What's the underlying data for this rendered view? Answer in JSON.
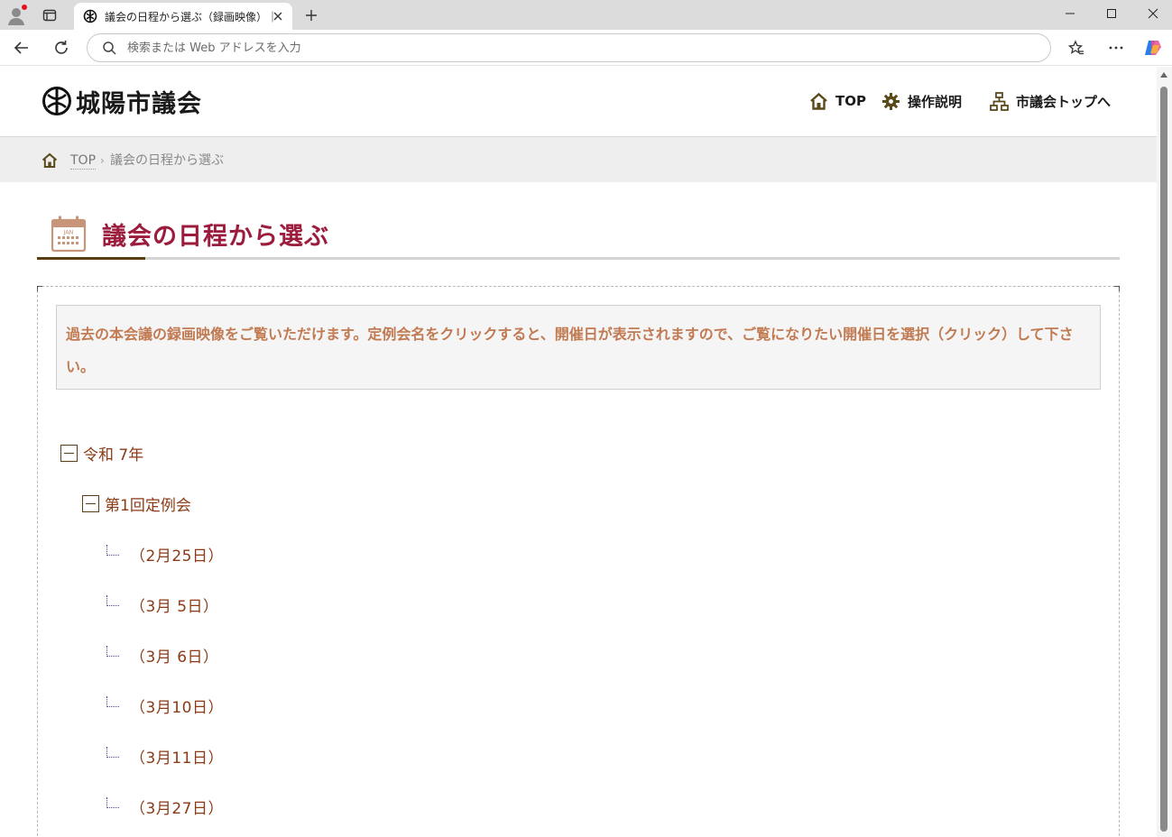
{
  "browser": {
    "tab_title": "議会の日程から選ぶ（録画映像）｜",
    "address_placeholder": "検索または Web アドレスを入力"
  },
  "site": {
    "logo_text": "城陽市議会",
    "nav": [
      {
        "label": "TOP",
        "icon": "home-icon"
      },
      {
        "label": "操作説明",
        "icon": "gear-icon"
      },
      {
        "label": "市議会トップへ",
        "icon": "sitemap-icon"
      }
    ]
  },
  "breadcrumb": {
    "home": "TOP",
    "separator": "›",
    "current": "議会の日程から選ぶ"
  },
  "page": {
    "title": "議会の日程から選ぶ",
    "calendar_label": "JAN",
    "notice": "過去の本会議の録画映像をご覧いただけます。定例会名をクリックすると、開催日が表示されますので、ご覧になりたい開催日を選択（クリック）して下さい。"
  },
  "tree": {
    "year": "令和 7年",
    "session": "第1回定例会",
    "dates": [
      "（2月25日）",
      "（3月 5日）",
      "（3月 6日）",
      "（3月10日）",
      "（3月11日）",
      "（3月27日）"
    ]
  },
  "colors": {
    "title": "#9b1c3c",
    "notice_text": "#c17a52",
    "tree_text": "#8b3a14",
    "accent": "#5a3e12"
  }
}
